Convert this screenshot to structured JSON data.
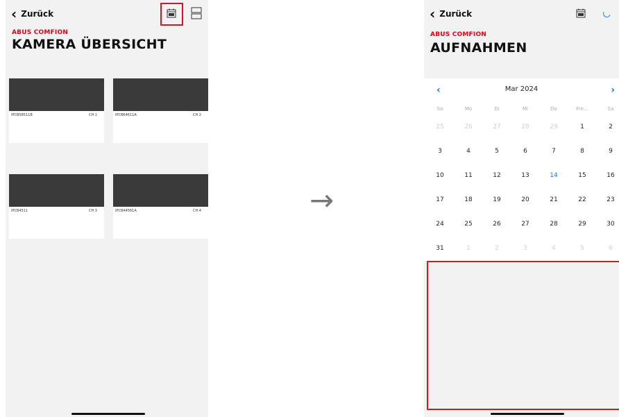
{
  "left_screen": {
    "back_label": "Zurück",
    "brand": "ABUS COMFION",
    "title": "KAMERA ÜBERSICHT",
    "cameras": [
      {
        "name": "IPCB58511B",
        "channel": "CH 1"
      },
      {
        "name": "IPCB64611A",
        "channel": "CH 2"
      },
      {
        "name": "IPCB4511",
        "channel": "CH 3"
      },
      {
        "name": "IPCB44561A",
        "channel": "CH 4"
      }
    ]
  },
  "transition_arrow": "→",
  "right_screen": {
    "back_label": "Zurück",
    "brand": "ABUS COMFION",
    "title": "AUFNAHMEN",
    "calendar": {
      "prev": "‹",
      "next": "›",
      "month_label": "Mar 2024",
      "weekdays": [
        "So",
        "Mo",
        "Di",
        "Mi",
        "Do",
        "Fre...",
        "Sa"
      ],
      "today": "14",
      "weeks": [
        [
          "25",
          "26",
          "27",
          "28",
          "29",
          "1",
          "2"
        ],
        [
          "3",
          "4",
          "5",
          "6",
          "7",
          "8",
          "9"
        ],
        [
          "10",
          "11",
          "12",
          "13",
          "14",
          "15",
          "16"
        ],
        [
          "17",
          "18",
          "19",
          "20",
          "21",
          "22",
          "23"
        ],
        [
          "24",
          "25",
          "26",
          "27",
          "28",
          "29",
          "30"
        ],
        [
          "31",
          "1",
          "2",
          "3",
          "4",
          "5",
          "6"
        ]
      ]
    }
  },
  "colors": {
    "accent_red": "#e2001a",
    "highlight_red": "#e01020",
    "link_blue": "#1a73e8",
    "video_dark": "#3a3a3a"
  }
}
